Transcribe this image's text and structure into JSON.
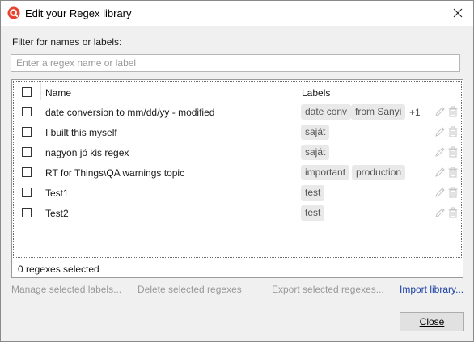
{
  "window": {
    "title": "Edit your Regex library"
  },
  "filter": {
    "label": "Filter for names or labels:",
    "placeholder": "Enter a regex name or label",
    "value": ""
  },
  "table": {
    "headers": {
      "name": "Name",
      "labels": "Labels"
    },
    "rows": [
      {
        "name": "date conversion to mm/dd/yy - modified",
        "labels": [
          "date conv",
          "from Sanyi"
        ],
        "more": "+1"
      },
      {
        "name": "I built this myself",
        "labels": [
          "saját"
        ]
      },
      {
        "name": "nagyon jó kis regex",
        "labels": [
          "saját"
        ]
      },
      {
        "name": "RT for Things\\QA warnings topic",
        "labels": [
          "important",
          "production"
        ]
      },
      {
        "name": "Test1",
        "labels": [
          "test"
        ]
      },
      {
        "name": "Test2",
        "labels": [
          "test"
        ]
      }
    ]
  },
  "status": {
    "selected_text": "0 regexes selected"
  },
  "actions": {
    "manage_labels": "Manage selected labels...",
    "delete_selected": "Delete selected regexes",
    "export_selected": "Export selected regexes...",
    "import_library": "Import library..."
  },
  "buttons": {
    "close": "Close"
  },
  "colors": {
    "accent": "#e8432e",
    "link": "#1a3fa6",
    "disabled_text": "#9a9a9a",
    "chip_bg": "#e9e9e9"
  },
  "icons": {
    "app": "app-logo-icon",
    "window_close": "close-icon",
    "row_edit": "pencil-icon",
    "row_delete": "trash-icon"
  }
}
